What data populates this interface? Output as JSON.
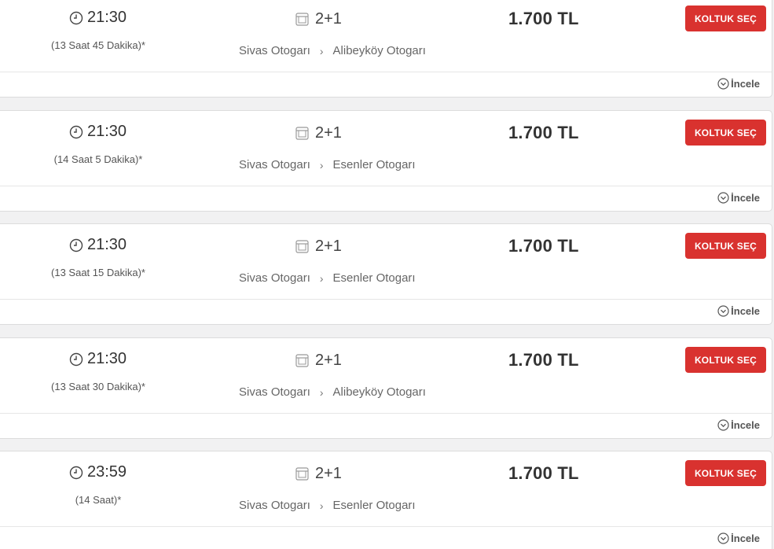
{
  "trips": [
    {
      "time": "21:30",
      "duration": "(13 Saat 45 Dakika)*",
      "seat_layout": "2+1",
      "from": "Sivas Otogarı",
      "to": "Alibeyköy Otogarı",
      "price": "1.700 TL",
      "button_label": "KOLTUK SEÇ",
      "details_label": "İncele"
    },
    {
      "time": "21:30",
      "duration": "(14 Saat 5 Dakika)*",
      "seat_layout": "2+1",
      "from": "Sivas Otogarı",
      "to": "Esenler Otogarı",
      "price": "1.700 TL",
      "button_label": "KOLTUK SEÇ",
      "details_label": "İncele"
    },
    {
      "time": "21:30",
      "duration": "(13 Saat 15 Dakika)*",
      "seat_layout": "2+1",
      "from": "Sivas Otogarı",
      "to": "Esenler Otogarı",
      "price": "1.700 TL",
      "button_label": "KOLTUK SEÇ",
      "details_label": "İncele"
    },
    {
      "time": "21:30",
      "duration": "(13 Saat 30 Dakika)*",
      "seat_layout": "2+1",
      "from": "Sivas Otogarı",
      "to": "Alibeyköy Otogarı",
      "price": "1.700 TL",
      "button_label": "KOLTUK SEÇ",
      "details_label": "İncele"
    },
    {
      "time": "23:59",
      "duration": "(14 Saat)*",
      "seat_layout": "2+1",
      "from": "Sivas Otogarı",
      "to": "Esenler Otogarı",
      "price": "1.700 TL",
      "button_label": "KOLTUK SEÇ",
      "details_label": "İncele"
    }
  ],
  "icons": {
    "time": "clock-icon",
    "seat": "seat-icon",
    "route_separator": "chevron-right-icon",
    "details": "chevron-down-circle-icon"
  },
  "colors": {
    "accent": "#d9322f",
    "background": "#f1f1f2",
    "card": "#ffffff"
  }
}
